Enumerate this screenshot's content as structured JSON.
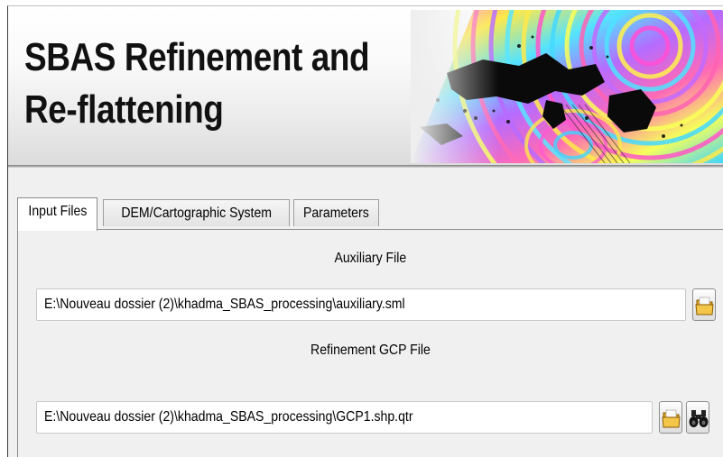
{
  "header": {
    "title_line1": "SBAS Refinement and",
    "title_line2": "Re-flattening"
  },
  "tabs": [
    {
      "label": "Input Files",
      "active": true
    },
    {
      "label": "DEM/Cartographic System",
      "active": false
    },
    {
      "label": "Parameters",
      "active": false
    }
  ],
  "input_files": {
    "auxiliary_label": "Auxiliary File",
    "auxiliary_value": "E:\\Nouveau dossier (2)\\khadma_SBAS_processing\\auxiliary.sml",
    "gcp_label": "Refinement GCP File",
    "gcp_value": "E:\\Nouveau dossier (2)\\khadma_SBAS_processing\\GCP1.shp.qtr"
  },
  "icons": {
    "open_folder": "folder-open-icon",
    "browse": "binoculars-icon"
  }
}
